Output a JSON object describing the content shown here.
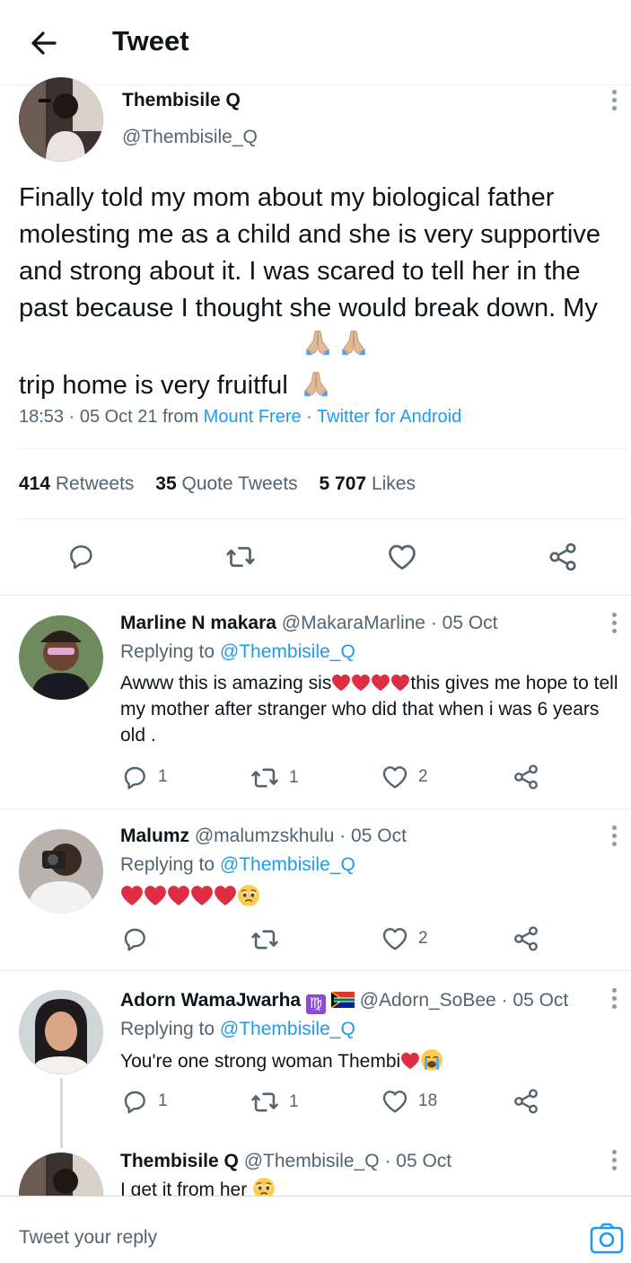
{
  "header": {
    "title": "Tweet"
  },
  "tweet": {
    "name": "Thembisile Q",
    "handle": "@Thembisile_Q",
    "text": "Finally told my mom about my biological father molesting me as a child and she is very supportive and strong about it. I was scared to tell her in the past because I thought she would break down. My trip home is very fruitful",
    "emoji": "🙏🏽🙏🏽🙏🏽",
    "time": "18:53 · 05 Oct 21 from",
    "location": "Mount Frere",
    "separator": "·",
    "source": "Twitter for Android",
    "retweets_count": "414",
    "retweets_label": "Retweets",
    "quotes_count": "35",
    "quotes_label": "Quote Tweets",
    "likes_count": "5 707",
    "likes_label": "Likes"
  },
  "replies": [
    {
      "name": "Marline N makara",
      "handle": "@MakaraMarline",
      "date": "· 05 Oct",
      "replying_prefix": "Replying to",
      "replying_to": "@Thembisile_Q",
      "text_before": "Awww this is amazing sis",
      "text_after": "this gives me hope to tell my mother after stranger who did that when i was 6 years old .",
      "reply_count": "1",
      "retweet_count": "1",
      "like_count": "2"
    },
    {
      "name": "Malumz",
      "handle": "@malumzskhulu",
      "date": "· 05 Oct",
      "replying_prefix": "Replying to",
      "replying_to": "@Thembisile_Q",
      "emoji": "🥺",
      "reply_count": "",
      "retweet_count": "",
      "like_count": "2"
    },
    {
      "name": "Adorn WamaJwarha",
      "name_emoji": "♍",
      "handle": "@Adorn_SoBee",
      "date": "· 05 Oct",
      "replying_prefix": "Replying to",
      "replying_to": "@Thembisile_Q",
      "text": "You're one strong woman Thembi",
      "emoji": "😭",
      "reply_count": "1",
      "retweet_count": "1",
      "like_count": "18"
    },
    {
      "name": "Thembisile Q",
      "handle": "@Thembisile_Q",
      "date": "· 05 Oct",
      "text": "I get it from her",
      "emoji": "🥺"
    }
  ],
  "composer": {
    "placeholder": "Tweet your reply"
  },
  "colors": {
    "accent": "#1d9bf0",
    "heart": "#e0245e",
    "muted": "#536471"
  },
  "icons": [
    "back-arrow-icon",
    "more-icon",
    "reply-icon",
    "retweet-icon",
    "like-icon",
    "share-icon",
    "camera-icon",
    "heart-emoji-icon",
    "sa-flag-icon"
  ]
}
